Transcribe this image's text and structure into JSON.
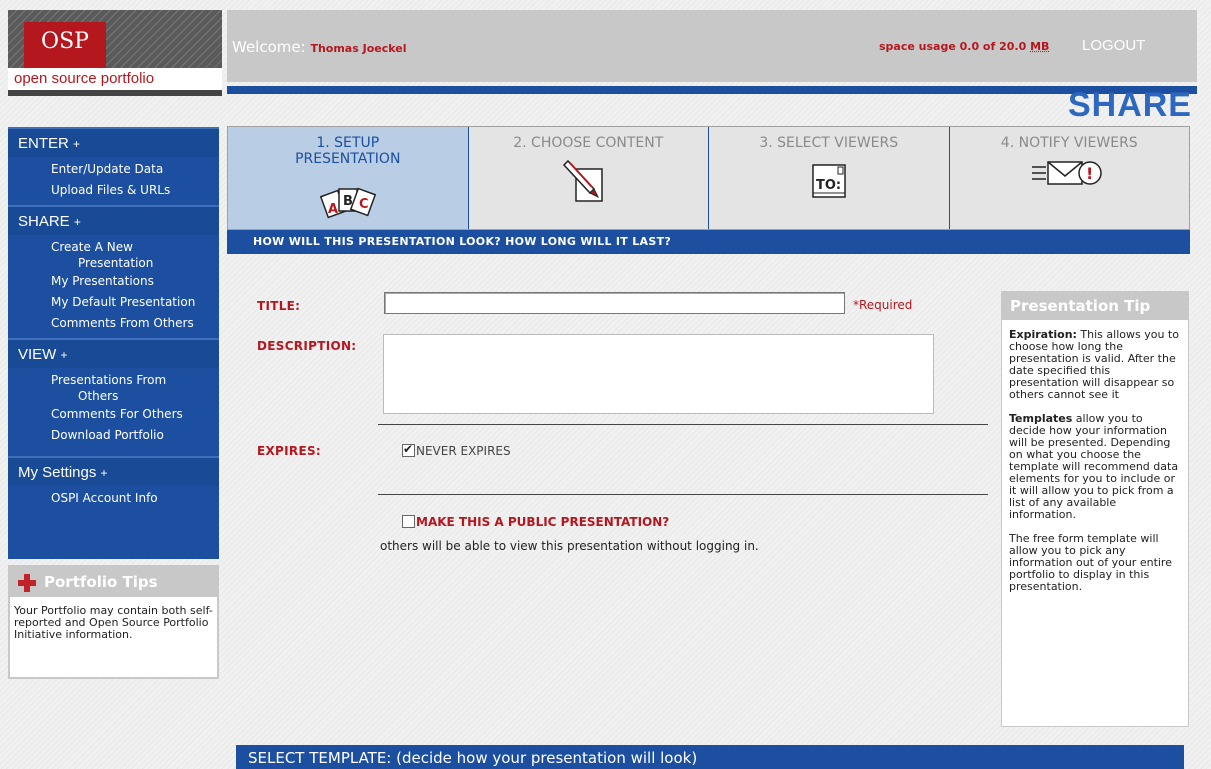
{
  "logo": {
    "mark": "OSP",
    "subtitle": "open source portfolio"
  },
  "header": {
    "welcome_label": "Welcome:",
    "user_name": "Thomas Joeckel",
    "space_usage_prefix": "space usage 0.0 of 20.0 ",
    "space_usage_unit": "MB",
    "logout_label": "LOGOUT",
    "section_title": "SHARE"
  },
  "sidebar": {
    "enter": {
      "label": "ENTER",
      "items": [
        "Enter/Update Data",
        "Upload Files & URLs"
      ]
    },
    "share": {
      "label": "SHARE",
      "create_line1": "Create A New",
      "create_line2": "Presentation",
      "items": [
        "My Presentations",
        "My Default Presentation",
        "Comments From Others"
      ]
    },
    "view": {
      "label": "VIEW",
      "pres_line1": "Presentations From",
      "pres_line2": "Others",
      "items": [
        "Comments For Others",
        "Download Portfolio"
      ]
    },
    "settings": {
      "label": "My Settings",
      "items": [
        "OSPI Account Info"
      ]
    },
    "plus_glyph": "+"
  },
  "portfolio_tips": {
    "title": "Portfolio Tips",
    "text": "Your Portfolio may contain both self-reported and Open Source Portfolio Initiative information."
  },
  "steps": [
    {
      "line1": "1. SETUP",
      "line2": "PRESENTATION",
      "icon": "abc-cards-icon",
      "active": true
    },
    {
      "line1": "2. CHOOSE CONTENT",
      "line2": "",
      "icon": "pencil-paper-icon",
      "active": false
    },
    {
      "line1": "3. SELECT VIEWERS",
      "line2": "",
      "icon": "to-address-icon",
      "active": false
    },
    {
      "line1": "4. NOTIFY VIEWERS",
      "line2": "",
      "icon": "envelope-alert-icon",
      "active": false
    }
  ],
  "step_icon_text": {
    "abc": [
      "A",
      "B",
      "C"
    ],
    "to": "TO:",
    "alert": "!"
  },
  "step_bar_text": "HOW WILL THIS PRESENTATION LOOK? HOW LONG WILL IT LAST?",
  "form": {
    "title_label": "TITLE:",
    "title_value": "",
    "required_text": "*Required",
    "description_label": "DESCRIPTION:",
    "description_value": "",
    "expires_label": "EXPIRES:",
    "never_expires_label": "NEVER EXPIRES",
    "never_expires_checked": true,
    "public_label": "MAKE THIS A PUBLIC PRESENTATION?",
    "public_checked": false,
    "public_note": "others will be able to view this presentation without logging in."
  },
  "presentation_tip": {
    "title": "Presentation Tip",
    "expiration_term": "Expiration:",
    "expiration_text": " This allows you to choose how long the presentation is valid. After the date specified this presentation will disappear so others cannot see it",
    "templates_term": "Templates",
    "templates_text": " allow you to decide how your information will be presented. Depending on what you choose the template will recommend data elements for you to include or it will allow you to pick from a list of any available information.",
    "freeform_text": "The free form template will allow you to pick any information out of your entire portfolio to display in this presentation."
  },
  "select_template_text": "SELECT TEMPLATE: (decide how your presentation will look)",
  "colors": {
    "brand_red": "#b5171f",
    "nav_blue": "#1c4fa0",
    "header_gray": "#c8c8c8",
    "active_step": "#b9cde5"
  }
}
